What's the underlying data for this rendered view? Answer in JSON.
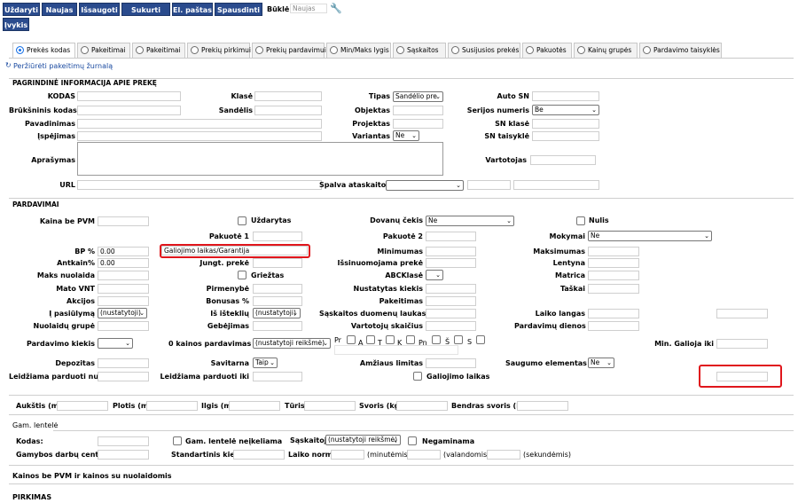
{
  "toolbar": {
    "buttons": [
      "Uždaryti",
      "Naujas",
      "Išsaugoti",
      "Sukurti prekę",
      "El. paštas",
      "Spausdinti"
    ],
    "status_label": "Būklė:",
    "status_value": "Naujas",
    "ivykis": "Įvykis"
  },
  "tabs": [
    "Prekės kodas",
    "Pakeitimai",
    "Pakeitimai",
    "Prekių pirkimui",
    "Prekių pardavimui",
    "Min/Maks lygis",
    "Sąskaitos",
    "Susijusios prekės",
    "Pakuotės",
    "Kainų grupės",
    "Pardavimo taisyklės"
  ],
  "journal_link": "Peržiūrėti pakeitimų žurnalą",
  "sections": {
    "basic": "PAGRINDINĖ INFORMACIJA APIE PREKĘ",
    "sales": "PARDAVIMAI",
    "producer": "Gam. lentelė",
    "price_note": "Kainos be PVM ir kainos su nuolaidomis",
    "purchase": "PIRKIMAS"
  },
  "basic": {
    "kodas": "KODAS",
    "klase": "Klasė",
    "tipas": "Tipas",
    "tipas_value": "Sandėlio pre",
    "auto_sn": "Auto SN",
    "bruksninis": "Brūkšninis kodas",
    "sandelis": "Sandėlis",
    "objektas": "Objektas",
    "serijos": "Serijos numeris",
    "serijos_value": "Be",
    "pavadinimas": "Pavadinimas",
    "projektas": "Projektas",
    "sn_klase": "SN klasė",
    "ispejimas": "Įspėjimas",
    "variantas": "Variantas",
    "variantas_value": "Ne",
    "sn_taisykle": "SN taisyklė",
    "aprasymas": "Aprašymas",
    "vartotojas": "Vartotojas",
    "url": "URL",
    "spalva": "Spalva ataskaitose"
  },
  "sales": {
    "kaina_be_pvm": "Kaina be PVM",
    "uzdarytas": "Uždarytas",
    "dovanu": "Dovanų čekis",
    "dovanu_value": "Ne",
    "nulis": "Nulis",
    "pakuote1": "Pakuotė 1",
    "pakuote2": "Pakuotė 2",
    "mokymai": "Mokymai",
    "mokymai_value": "Ne",
    "bp": "BP %",
    "bp_value": "0.00",
    "galiojimo_input": "Galiojimo laikas/Garantija",
    "minimumas": "Minimumas",
    "maksimumas": "Maksimumas",
    "antkain": "Antkain%",
    "antkain_value": "0.00",
    "jungt": "Jungt. prekė",
    "issinuomojama": "Išsinuomojama prekė",
    "lentyna": "Lentyna",
    "maks_nuolaida": "Maks nuolaida",
    "griezta": "Griežtas",
    "abcklase": "ABCKlasė",
    "matrica": "Matrica",
    "mato_vnt": "Mato VNT",
    "pirmenybe": "Pirmenybė",
    "nustatytas": "Nustatytas kiekis",
    "taskai": "Taškai",
    "akcijos": "Akcijos",
    "bonusas": "Bonusas %",
    "pakeitimas": "Pakeitimas",
    "pasiulyma": "Į pasiūlymą",
    "pasiulyma_value": "(nustatytoji)",
    "is_istekliu": "Iš išteklių",
    "is_istekliu_value": "(nustatytoji)",
    "saskaitos_duom": "Sąskaitos duomenų laukas",
    "laiko_langas": "Laiko langas",
    "nuolaidu": "Nuolaidų grupė",
    "gebejimas": "Gebėjimas",
    "vartotoju": "Vartotojų skaičius",
    "pardavimu_dienos": "Pardavimų dienos",
    "pardavimo_kiekis": "Pardavimo kiekis",
    "nulio_kainos": "0 kainos pardavimas",
    "nulio_kainos_value": "(nustatytoji reikšmė)",
    "days": [
      "Pr",
      "A",
      "T",
      "K",
      "Pn",
      "Š",
      "S"
    ],
    "min_galioja": "Min. Galioja iki",
    "depozitas": "Depozitas",
    "savitarna": "Savitarna",
    "savitarna_value": "Taip",
    "amziaus": "Amžiaus limitas",
    "saugumo": "Saugumo elementas",
    "saugumo_value": "Ne",
    "leidziama_nuo": "Leidžiama parduoti nuo",
    "leidziama_iki": "Leidžiama parduoti iki",
    "galiojimo_laikas": "Galiojimo laikas"
  },
  "dims": {
    "aukstis": "Aukštis (m)",
    "plotis": "Plotis (m)",
    "ilgis": "Ilgis (m)",
    "turis": "Tūris",
    "svoris": "Svoris (kg)",
    "bendras": "Bendras svoris (kg)"
  },
  "producer": {
    "kodas": "Kodas:",
    "neikeliama": "Gam. lentelė neįkeliama",
    "saskaitoje": "Sąskaitoje",
    "saskaitoje_value": "(nustatytoji reikšmė)",
    "negaminama": "Negaminama",
    "centras": "Gamybos darbų centras",
    "standartinis": "Standartinis kiekis",
    "laiko_norma": "Laiko norma",
    "min": "(minutėmis)",
    "val": "(valandomis)",
    "sek": "(sekundėmis)"
  },
  "colors": {
    "toolbar": "#2a4b8d",
    "highlight": "#e0161c",
    "tab_active": "#1a73e8"
  }
}
